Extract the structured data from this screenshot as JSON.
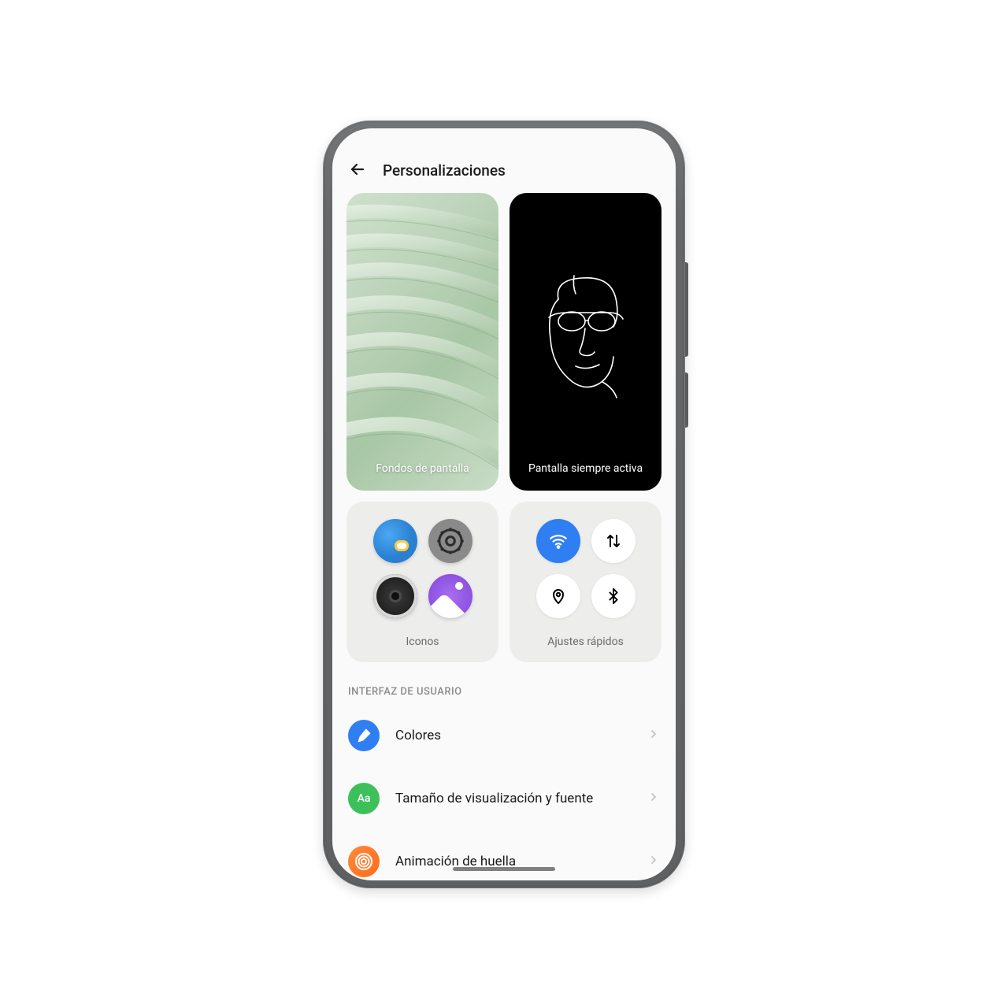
{
  "header": {
    "title": "Personalizaciones"
  },
  "tiles": {
    "wallpaper_label": "Fondos de pantalla",
    "aod_label": "Pantalla siempre activa",
    "icons_label": "Iconos",
    "qs_label": "Ajustes rápidos"
  },
  "section": {
    "ui_label": "INTERFAZ DE USUARIO"
  },
  "list": {
    "colors": "Colores",
    "display_font": "Tamaño de visualización y fuente",
    "fingerprint": "Animación de huella",
    "font_icon_text": "Aa"
  }
}
